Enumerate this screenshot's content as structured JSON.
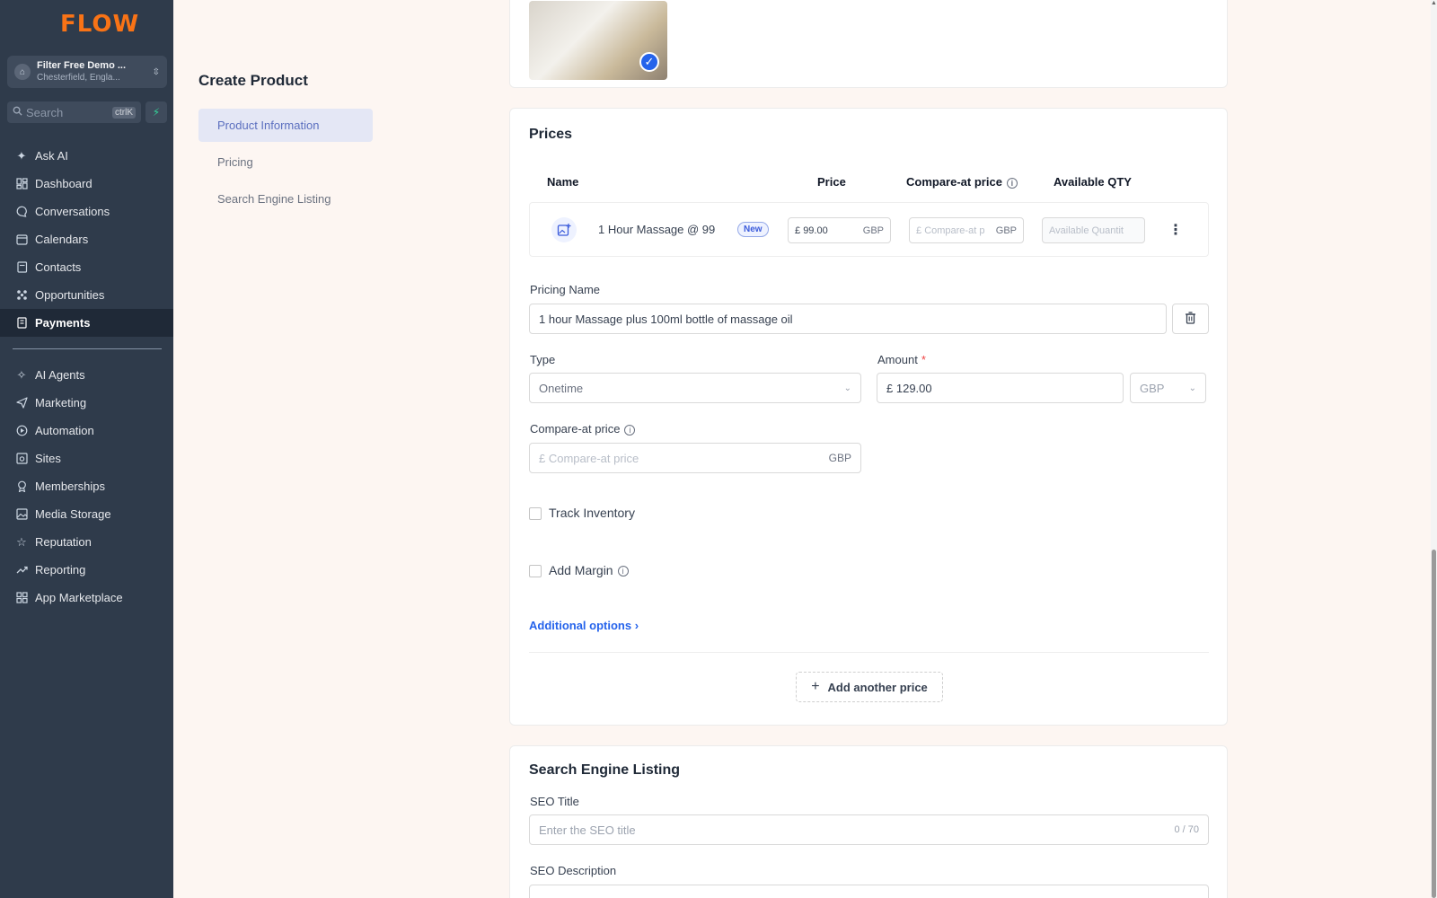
{
  "sidebar": {
    "logo": "FLOW",
    "account": {
      "name": "Filter Free Demo ...",
      "location": "Chesterfield, Engla..."
    },
    "search": {
      "placeholder": "Search",
      "shortcut": "ctrlK"
    },
    "nav_top": [
      {
        "label": "Ask AI",
        "icon": "sparkle-icon"
      },
      {
        "label": "Dashboard",
        "icon": "grid-icon"
      },
      {
        "label": "Conversations",
        "icon": "chat-icon"
      },
      {
        "label": "Calendars",
        "icon": "calendar-icon"
      },
      {
        "label": "Contacts",
        "icon": "contacts-icon"
      },
      {
        "label": "Opportunities",
        "icon": "opportunities-icon"
      },
      {
        "label": "Payments",
        "icon": "payments-icon",
        "active": true
      }
    ],
    "nav_bottom": [
      {
        "label": "AI Agents",
        "icon": "ai-agents-icon"
      },
      {
        "label": "Marketing",
        "icon": "send-icon"
      },
      {
        "label": "Automation",
        "icon": "automation-icon"
      },
      {
        "label": "Sites",
        "icon": "sites-icon"
      },
      {
        "label": "Memberships",
        "icon": "award-icon"
      },
      {
        "label": "Media Storage",
        "icon": "image-icon"
      },
      {
        "label": "Reputation",
        "icon": "star-icon"
      },
      {
        "label": "Reporting",
        "icon": "trend-icon"
      },
      {
        "label": "App Marketplace",
        "icon": "apps-icon"
      }
    ]
  },
  "subnav": {
    "title": "Create Product",
    "items": [
      "Product Information",
      "Pricing",
      "Search Engine Listing"
    ]
  },
  "prices": {
    "title": "Prices",
    "columns": {
      "name": "Name",
      "price": "Price",
      "compare": "Compare-at price",
      "qty": "Available QTY"
    },
    "row": {
      "name": "1 Hour Massage @ 99",
      "badge": "New",
      "price_prefix": "£",
      "price": "99.00",
      "currency": "GBP",
      "compare_placeholder": "Compare-at p",
      "qty_placeholder": "Available Quantit"
    },
    "pricing_name_label": "Pricing Name",
    "pricing_name_value": "1 hour Massage plus 100ml bottle of massage oil",
    "type_label": "Type",
    "type_value": "Onetime",
    "amount_label": "Amount",
    "amount_required": "*",
    "amount_prefix": "£",
    "amount_value": "129.00",
    "amount_currency": "GBP",
    "compare_label": "Compare-at price",
    "compare_prefix": "£",
    "compare_placeholder": "Compare-at price",
    "compare_currency": "GBP",
    "track_inventory": "Track Inventory",
    "add_margin": "Add Margin",
    "additional_options": "Additional options",
    "add_another": "Add another price"
  },
  "seo": {
    "title": "Search Engine Listing",
    "seo_title_label": "SEO Title",
    "seo_title_placeholder": "Enter the SEO title",
    "seo_title_counter": "0 / 70",
    "seo_desc_label": "SEO Description"
  },
  "colors": {
    "sidebar": "#2f3b4b",
    "accent": "#2563eb",
    "logo": "#f97316"
  }
}
